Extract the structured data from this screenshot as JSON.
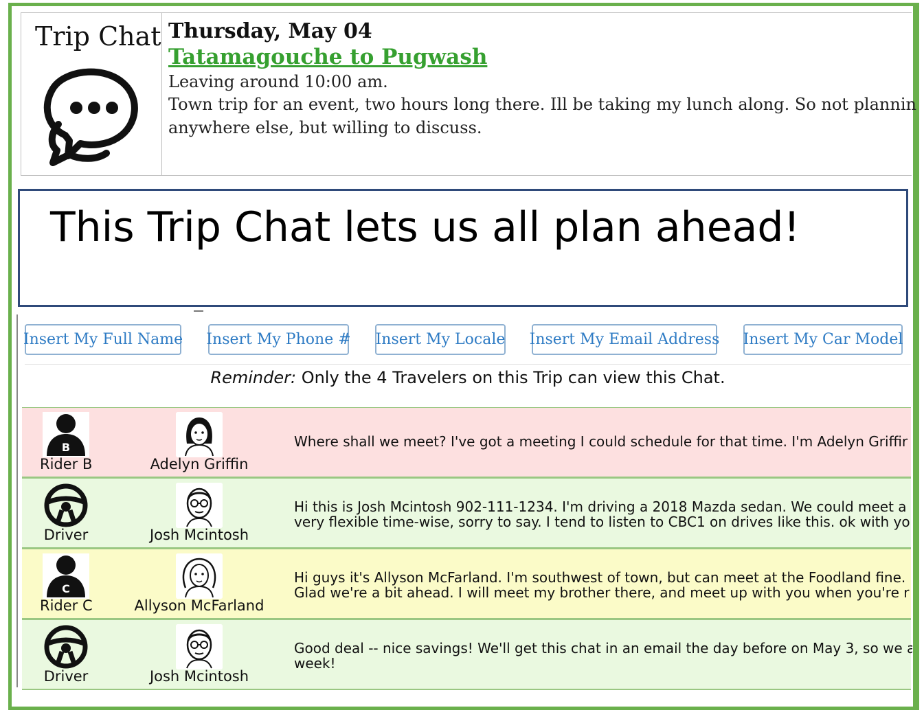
{
  "app": {
    "title": "Trip Chat",
    "icon": "chat-bubbles-icon",
    "accent_color": "#6ab04c",
    "route_color": "#36a030"
  },
  "trip": {
    "date": "Thursday, May 04",
    "route": "Tatamagouche to Pugwash",
    "leaving": "Leaving around 10:00 am.",
    "desc_line1": "Town trip for an event, two hours long there. Ill be taking my lunch along. So not plannin",
    "desc_line2": "anywhere else, but willing to discuss."
  },
  "banner": {
    "text": "This Trip Chat lets us all plan ahead!"
  },
  "buttons": {
    "full_name": "Insert My Full Name",
    "phone": "Insert My Phone #",
    "locale": "Insert My Locale",
    "email": "Insert My Email Address",
    "car": "Insert My Car Model"
  },
  "reminder": {
    "prefix": "Reminder:",
    "text": " Only the 4 Travelers on this Trip can view this Chat."
  },
  "messages": [
    {
      "role": "Rider B",
      "role_icon": "rider-b-icon",
      "name": "Adelyn Griffin",
      "avatar": "woman-avatar-icon",
      "line1": "Where shall we meet? I've got a meeting I could schedule for that time. I'm Adelyn Griffir",
      "line2": "",
      "color": "#fde0e0"
    },
    {
      "role": "Driver",
      "role_icon": "steering-wheel-icon",
      "name": "Josh Mcintosh",
      "avatar": "man-glasses-avatar-icon",
      "line1": "Hi this is Josh Mcintosh 902-111-1234. I'm driving a 2018 Mazda sedan. We could meet a",
      "line2": "very flexible time-wise, sorry to say. I tend to listen to CBC1 on drives like this. ok with yo",
      "color": "#eaf9e0"
    },
    {
      "role": "Rider C",
      "role_icon": "rider-c-icon",
      "name": "Allyson McFarland",
      "avatar": "woman-curly-avatar-icon",
      "line1": "Hi guys it's Allyson McFarland. I'm southwest of town, but can meet at the Foodland fine.",
      "line2": "Glad we're a bit ahead. I will meet my brother there, and meet up with you when you're r",
      "color": "#fbfbc8"
    },
    {
      "role": "Driver",
      "role_icon": "steering-wheel-icon",
      "name": "Josh Mcintosh",
      "avatar": "man-glasses-avatar-icon",
      "line1": "Good deal -- nice savings! We'll get this chat in an email the day before on May 3, so we a",
      "line2": "week!",
      "color": "#eaf9e0"
    }
  ]
}
